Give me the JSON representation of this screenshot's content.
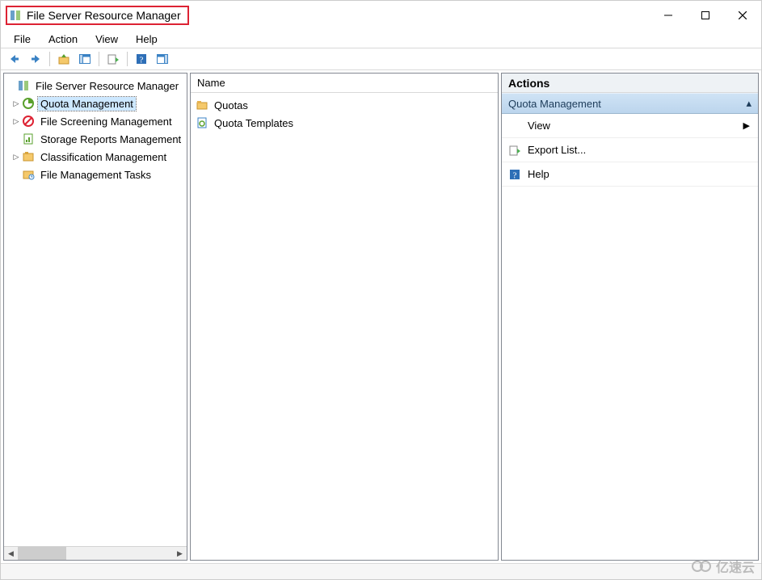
{
  "window": {
    "title": "File Server Resource Manager"
  },
  "menus": {
    "file": "File",
    "action": "Action",
    "view": "View",
    "help": "Help"
  },
  "tree": {
    "root": "File Server Resource Manager",
    "items": [
      {
        "label": "Quota Management",
        "expandable": true,
        "selected": true
      },
      {
        "label": "File Screening Management",
        "expandable": true
      },
      {
        "label": "Storage Reports Management",
        "expandable": false
      },
      {
        "label": "Classification Management",
        "expandable": true
      },
      {
        "label": "File Management Tasks",
        "expandable": false
      }
    ]
  },
  "list": {
    "header": "Name",
    "items": [
      {
        "label": "Quotas"
      },
      {
        "label": "Quota Templates"
      }
    ]
  },
  "actions": {
    "title": "Actions",
    "section": "Quota Management",
    "items": {
      "view": "View",
      "export": "Export List...",
      "help": "Help"
    }
  },
  "watermark": "亿速云"
}
